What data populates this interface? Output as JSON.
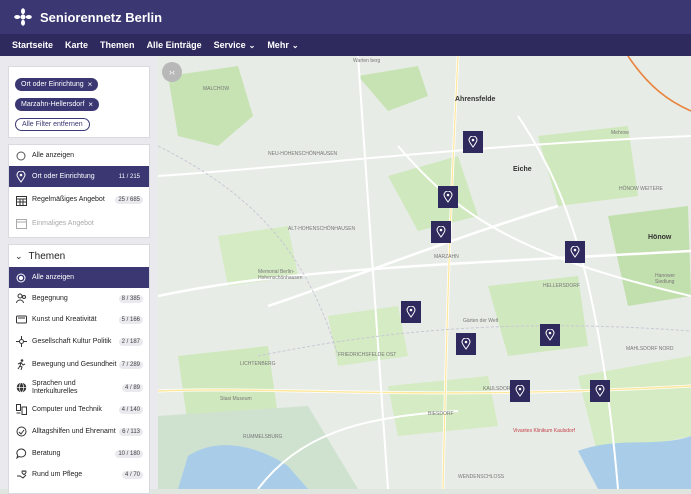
{
  "header": {
    "site_title": "Seniorennetz Berlin"
  },
  "nav": {
    "items": [
      {
        "label": "Startseite",
        "has_menu": false
      },
      {
        "label": "Karte",
        "has_menu": false
      },
      {
        "label": "Themen",
        "has_menu": false
      },
      {
        "label": "Alle Einträge",
        "has_menu": false
      },
      {
        "label": "Service",
        "has_menu": true
      },
      {
        "label": "Mehr",
        "has_menu": true
      }
    ]
  },
  "filters": {
    "chips": [
      "Ort oder Einrichtung",
      "Marzahn-Hellersdorf"
    ],
    "clear_label": "Alle Filter entfernen"
  },
  "types": [
    {
      "label": "Alle anzeigen",
      "count": "",
      "icon": "radio-icon",
      "active": false,
      "disabled": false
    },
    {
      "label": "Ort oder Einrichtung",
      "count": "11 / 215",
      "icon": "location-pin-icon",
      "active": true,
      "disabled": false
    },
    {
      "label": "Regelmäßiges Angebot",
      "count": "25 / 685",
      "icon": "calendar-grid-icon",
      "active": false,
      "disabled": false
    },
    {
      "label": "Einmaliges Angebot",
      "count": "",
      "icon": "calendar-single-icon",
      "active": false,
      "disabled": true
    }
  ],
  "themen": {
    "title": "Themen",
    "items": [
      {
        "label": "Alle anzeigen",
        "count": "",
        "icon": "radio-icon",
        "active": true
      },
      {
        "label": "Begegnung",
        "count": "8 / 385",
        "icon": "people-icon",
        "active": false
      },
      {
        "label": "Kunst und Kreativität",
        "count": "5 / 166",
        "icon": "palette-icon",
        "active": false
      },
      {
        "label": "Gesellschaft Kultur Politik",
        "count": "2 / 187",
        "icon": "society-icon",
        "active": false
      },
      {
        "label": "Bewegung und Gesundheit",
        "count": "7 / 289",
        "icon": "running-icon",
        "active": false
      },
      {
        "label": "Sprachen und Interkulturelles",
        "count": "4 / 89",
        "icon": "globe-icon",
        "active": false
      },
      {
        "label": "Computer und Technik",
        "count": "4 / 140",
        "icon": "computer-icon",
        "active": false
      },
      {
        "label": "Alltagshilfen und Ehrenamt",
        "count": "6 / 113",
        "icon": "helping-hands-icon",
        "active": false
      },
      {
        "label": "Beratung",
        "count": "10 / 180",
        "icon": "speech-bubble-icon",
        "active": false
      },
      {
        "label": "Rund um Pflege",
        "count": "4 / 70",
        "icon": "care-hand-icon",
        "active": false
      }
    ]
  },
  "map": {
    "labels": [
      {
        "text": "Ahrensfelde",
        "big": true
      },
      {
        "text": "Eiche",
        "big": true
      },
      {
        "text": "Hönow",
        "big": true
      },
      {
        "text": "Mehrow",
        "big": false
      },
      {
        "text": "Hanower Siedlung",
        "big": false
      },
      {
        "text": "MARZAHN",
        "big": false
      },
      {
        "text": "HELLERSDORF",
        "big": false
      },
      {
        "text": "LICHTENBERG",
        "big": false
      },
      {
        "text": "KAULSDORF",
        "big": false
      },
      {
        "text": "BIESDORF",
        "big": false
      },
      {
        "text": "Gärten der Welt",
        "big": false
      },
      {
        "text": "Vivantes Klinikum Kaulsdorf",
        "big": false
      },
      {
        "text": "Warten berg",
        "big": false
      },
      {
        "text": "MALCHOW",
        "big": false
      },
      {
        "text": "NEU-HOHENSCHÖNHAUSEN",
        "big": false
      },
      {
        "text": "ALT-HOHENSCHÖNHAUSEN",
        "big": false
      },
      {
        "text": "FRIEDRICHSFELDE OST",
        "big": false
      },
      {
        "text": "Stasi Museum",
        "big": false
      },
      {
        "text": "Memorial Berlin-Hohenschönhausen",
        "big": false
      },
      {
        "text": "MAHLSDORF NORD",
        "big": false
      },
      {
        "text": "HÖNOW WEITERE",
        "big": false
      },
      {
        "text": "RUMMELSBURG",
        "big": false
      },
      {
        "text": "WENDENSCHLOSS",
        "big": false
      }
    ],
    "marker_count": 11
  }
}
